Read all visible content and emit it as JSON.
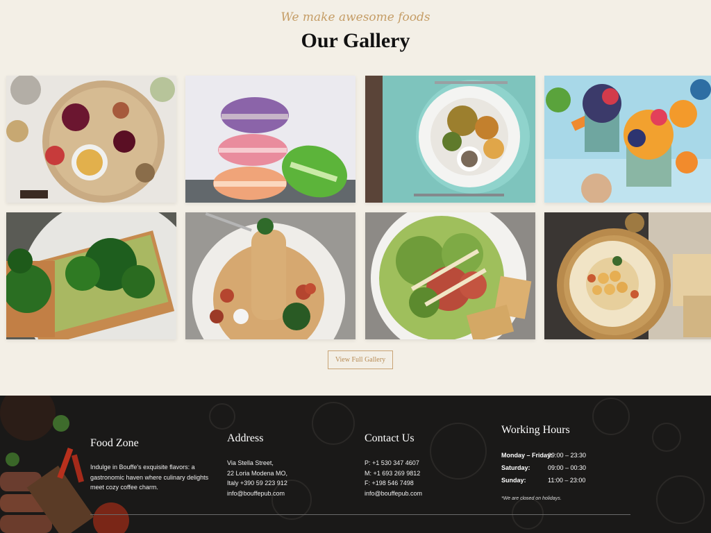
{
  "gallery": {
    "tagline": "We make awesome foods",
    "title": "Our Gallery",
    "images": [
      {
        "name": "charcuterie-board-image"
      },
      {
        "name": "macarons-image"
      },
      {
        "name": "plated-dish-image"
      },
      {
        "name": "fruit-parfaits-image"
      },
      {
        "name": "avocado-toast-image"
      },
      {
        "name": "spaghetti-image"
      },
      {
        "name": "caesar-salad-image"
      },
      {
        "name": "hummus-image"
      }
    ],
    "view_button": "View Full Gallery"
  },
  "footer": {
    "brand": {
      "title": "Food Zone",
      "text": "Indulge in Bouffe's exquisite flavors: a gastronomic haven where culinary delights meet cozy coffee charm."
    },
    "address": {
      "title": "Address",
      "lines": [
        "Via Stella Street,",
        "22 Loria Modena MO,",
        "Italy +390 59 223 912",
        "info@bouffepub.com"
      ]
    },
    "contact": {
      "title": "Contact Us",
      "lines": [
        "P: +1 530 347 4607",
        "M: +1 693 269 9812",
        "F: +198 546 7498",
        "info@bouffepub.com"
      ]
    },
    "hours": {
      "title": "Working Hours",
      "rows": [
        {
          "day": "Monday – Friday:",
          "time": "09:00 – 23:30"
        },
        {
          "day": "Saturday:",
          "time": "09:00 – 00:30"
        },
        {
          "day": "Sunday:",
          "time": "11:00 – 23:00"
        }
      ],
      "note": "*We are closed on holidays."
    }
  }
}
